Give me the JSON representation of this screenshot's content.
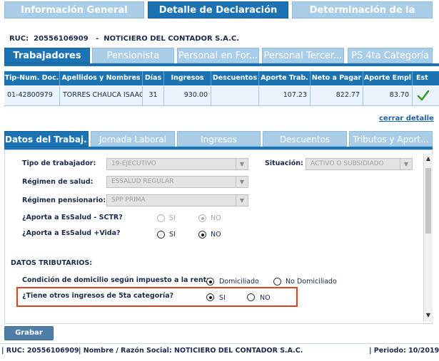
{
  "top_tabs": [
    "Información General",
    "Detalle de Declaración",
    "Determinación de la Deuda"
  ],
  "header": {
    "ruc_label": "RUC:",
    "ruc": "20556106909",
    "separator": "-",
    "company": "NOTICIERO DEL CONTADOR S.A.C."
  },
  "worker_tabs": [
    "Trabajadores",
    "Pensionista",
    "Personal en For...",
    "Personal Tercer...",
    "PS 4ta Categoría"
  ],
  "table": {
    "headers": [
      "Tip-Num. Doc.",
      "Apellidos y Nombres",
      "Días",
      "Ingresos",
      "Descuentos",
      "Aporte Trab.",
      "Neto a Pagar",
      "Aporte Empl",
      "Est"
    ],
    "rows": [
      {
        "doc": "01-42800979",
        "name": "TORRES CHAUCA ISAAC",
        "days": "31",
        "income": "930.00",
        "discounts": "",
        "worker_contrib": "107.23",
        "net": "822.77",
        "employer_contrib": "83.70",
        "status_icon": "check-icon"
      }
    ]
  },
  "close_detail": "cerrar detalle",
  "detail_tabs": [
    "Datos del Trabaj...",
    "Jornada Laboral",
    "Ingresos",
    "Descuentos",
    "Tributos y Aport..."
  ],
  "form": {
    "tipo_trabajador": {
      "label": "Tipo de trabajador:",
      "value": "19-EJECUTIVO"
    },
    "situacion": {
      "label": "Situación:",
      "value": "ACTIVO O SUBSIDIADO"
    },
    "regimen_salud": {
      "label": "Régimen de salud:",
      "value": "ESSALUD REGULAR"
    },
    "regimen_pensionario": {
      "label": "Régimen pensionario:",
      "value": "SPP PRIMA"
    },
    "sctr": {
      "label": "¿Aporta a EsSalud - SCTR?",
      "options": [
        "SI",
        "NO"
      ],
      "selected": "NO"
    },
    "vida": {
      "label": "¿Aporta a EsSalud +Vida?",
      "options": [
        "SI",
        "NO"
      ],
      "selected": "NO"
    },
    "tributarios_title": "DATOS TRIBUTARIOS:",
    "domicilio": {
      "label": "Condición de domicilio según impuesto a la renta",
      "options": [
        "Domiciliado",
        "No Domiciliado"
      ],
      "selected": "Domiciliado"
    },
    "quinta": {
      "label": "¿Tiene otros ingresos de 5ta categoría?",
      "options": [
        "SI",
        "NO"
      ],
      "selected": "SI"
    }
  },
  "save_button": "Grabar",
  "status_bar": {
    "ruc": "| RUC: 20556106909",
    "name": "| Nombre / Razón Social: NOTICIERO DEL CONTADOR S.A.C.",
    "period": "| Periodo: 10/2019"
  },
  "colors": {
    "primary": "#1b73b3",
    "tab_inactive": "#a9cde6",
    "highlight": "#e0401c",
    "check": "#3a9a2a"
  }
}
